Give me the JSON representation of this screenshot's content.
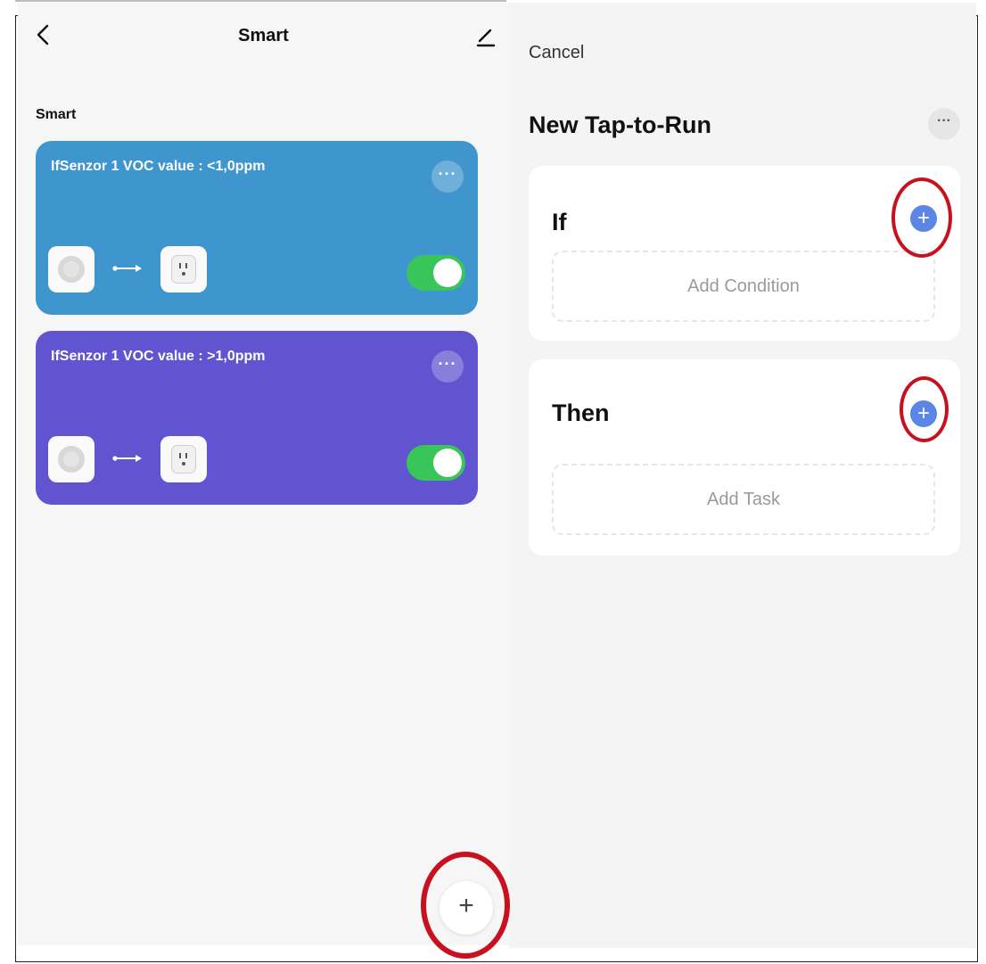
{
  "left_screen": {
    "header": {
      "title": "Smart",
      "back_icon": "chevron-left-icon",
      "edit_icon": "pencil-icon"
    },
    "section_label": "Smart",
    "scenes": [
      {
        "title": "IfSenzor 1 VOC value : <1,0ppm",
        "more_label": "···",
        "color": "#3f96cf",
        "condition_device_icon": "sensor-icon",
        "action_device_icon": "smart-plug-icon",
        "enabled": true
      },
      {
        "title": "IfSenzor 1 VOC value : >1,0ppm",
        "more_label": "···",
        "color": "#6154d1",
        "condition_device_icon": "sensor-icon",
        "action_device_icon": "smart-plug-icon",
        "enabled": true
      }
    ],
    "fab": {
      "label": "+",
      "icon": "plus-icon"
    },
    "toggle_color": "#38c65a"
  },
  "right_screen": {
    "cancel_label": "Cancel",
    "title": "New Tap-to-Run",
    "more_label": "···",
    "if_section": {
      "heading": "If",
      "add_icon": "plus-circle-icon",
      "add_label": "+",
      "placeholder": "Add Condition"
    },
    "then_section": {
      "heading": "Then",
      "add_icon": "plus-circle-icon",
      "add_label": "+",
      "placeholder": "Add Task"
    },
    "accent_color": "#5b86e5"
  },
  "annotation_color": "#c8101e"
}
